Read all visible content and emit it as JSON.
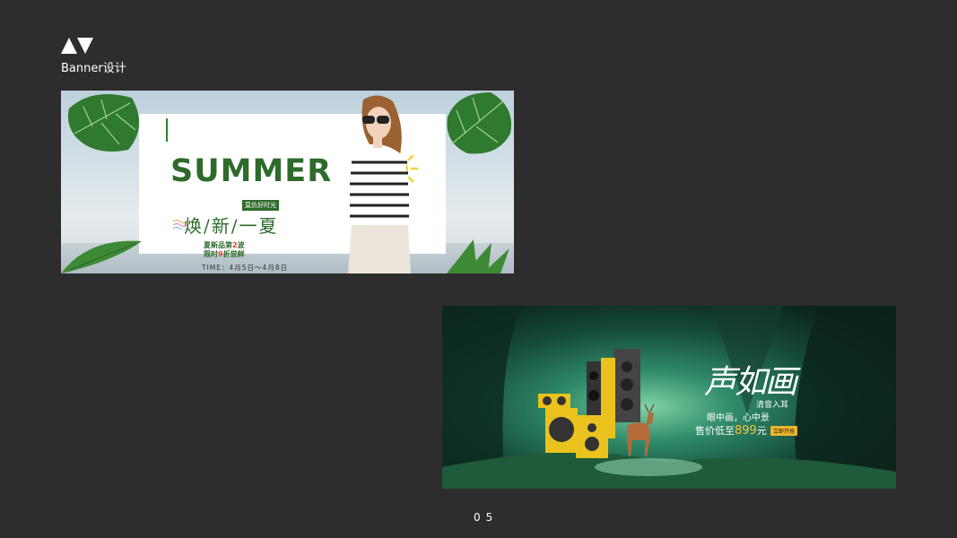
{
  "page": {
    "title": "Banner设计",
    "page_number": "05"
  },
  "banner1": {
    "headline": "SUMMER",
    "tag": "莫负好时光",
    "slogan": "焕/新/一夏",
    "info_line1_pre": "夏新品第",
    "info_line1_num": "2",
    "info_line1_post": "波",
    "info_line2_pre": "限时",
    "info_line2_num": "9",
    "info_line2_post": "折尝鲜",
    "timeline": "TIME：4月5日～4月8日",
    "dots": "• • • • •"
  },
  "banner2": {
    "title": "声如画",
    "sub1": "清音入耳",
    "sub2": "眼中画，心中景",
    "price_prefix": "售价低至",
    "price_num": "899",
    "price_unit": "元",
    "button": "立即开抢"
  }
}
